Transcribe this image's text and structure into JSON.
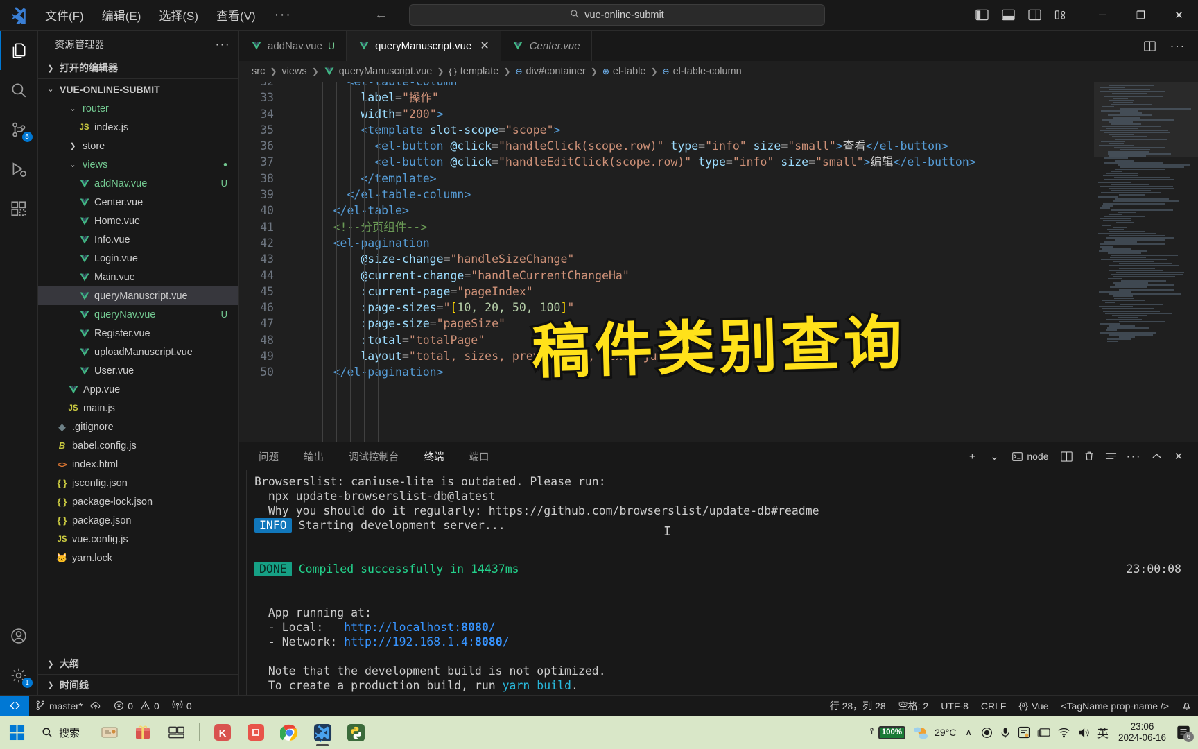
{
  "titlebar": {
    "menus": [
      "文件(F)",
      "编辑(E)",
      "选择(S)",
      "查看(V)"
    ],
    "more": "···",
    "back_icon": "←",
    "forward_icon": "→",
    "command_center_text": "vue-online-submit",
    "search_icon": "search-icon",
    "layout_icons": [
      "toggle-primary-sidebar-icon",
      "toggle-panel-icon",
      "toggle-secondary-sidebar-icon",
      "customize-layout-icon"
    ],
    "window_controls": {
      "minimize": "─",
      "maximize": "❐",
      "close": "✕"
    }
  },
  "activitybar": {
    "items": [
      {
        "name": "explorer",
        "icon": "files-icon",
        "badge": ""
      },
      {
        "name": "search",
        "icon": "search-icon",
        "badge": ""
      },
      {
        "name": "source-control",
        "icon": "source-control-icon",
        "badge": "5"
      },
      {
        "name": "run-and-debug",
        "icon": "debug-icon",
        "badge": ""
      },
      {
        "name": "extensions",
        "icon": "extensions-icon",
        "badge": ""
      }
    ],
    "bottom": [
      {
        "name": "accounts",
        "icon": "account-icon",
        "badge": ""
      },
      {
        "name": "manage",
        "icon": "gear-icon",
        "badge": "1"
      }
    ]
  },
  "sidebar": {
    "title": "资源管理器",
    "more": "···",
    "open_editors": "打开的编辑器",
    "project_name": "VUE-ONLINE-SUBMIT",
    "tree": [
      {
        "label": "router",
        "type": "folder",
        "open": true,
        "indent": 2,
        "badge": ""
      },
      {
        "label": "index.js",
        "type": "js",
        "indent": 3,
        "badge": ""
      },
      {
        "label": "store",
        "type": "folder",
        "open": false,
        "indent": 2,
        "badge": ""
      },
      {
        "label": "views",
        "type": "folder",
        "open": true,
        "indent": 2,
        "badge": "",
        "modified": true
      },
      {
        "label": "addNav.vue",
        "type": "vue",
        "indent": 3,
        "badge": "U",
        "untracked": true
      },
      {
        "label": "Center.vue",
        "type": "vue",
        "indent": 3,
        "badge": ""
      },
      {
        "label": "Home.vue",
        "type": "vue",
        "indent": 3,
        "badge": ""
      },
      {
        "label": "Info.vue",
        "type": "vue",
        "indent": 3,
        "badge": ""
      },
      {
        "label": "Login.vue",
        "type": "vue",
        "indent": 3,
        "badge": ""
      },
      {
        "label": "Main.vue",
        "type": "vue",
        "indent": 3,
        "badge": ""
      },
      {
        "label": "queryManuscript.vue",
        "type": "vue",
        "indent": 3,
        "badge": "",
        "selected": true
      },
      {
        "label": "queryNav.vue",
        "type": "vue",
        "indent": 3,
        "badge": "U",
        "untracked": true
      },
      {
        "label": "Register.vue",
        "type": "vue",
        "indent": 3,
        "badge": ""
      },
      {
        "label": "uploadManuscript.vue",
        "type": "vue",
        "indent": 3,
        "badge": ""
      },
      {
        "label": "User.vue",
        "type": "vue",
        "indent": 3,
        "badge": ""
      },
      {
        "label": "App.vue",
        "type": "vue",
        "indent": 2,
        "badge": ""
      },
      {
        "label": "main.js",
        "type": "js",
        "indent": 2,
        "badge": ""
      },
      {
        "label": ".gitignore",
        "type": "git",
        "indent": 1,
        "badge": ""
      },
      {
        "label": "babel.config.js",
        "type": "babel",
        "indent": 1,
        "badge": ""
      },
      {
        "label": "index.html",
        "type": "html",
        "indent": 1,
        "badge": ""
      },
      {
        "label": "jsconfig.json",
        "type": "json",
        "indent": 1,
        "badge": ""
      },
      {
        "label": "package-lock.json",
        "type": "json",
        "indent": 1,
        "badge": ""
      },
      {
        "label": "package.json",
        "type": "json",
        "indent": 1,
        "badge": ""
      },
      {
        "label": "vue.config.js",
        "type": "js",
        "indent": 1,
        "badge": ""
      },
      {
        "label": "yarn.lock",
        "type": "yarn",
        "indent": 1,
        "badge": ""
      }
    ],
    "outline": "大纲",
    "timeline": "时间线"
  },
  "editor": {
    "tabs": [
      {
        "label": "addNav.vue",
        "badge": "U",
        "active": false,
        "preview": false,
        "closable": false
      },
      {
        "label": "queryManuscript.vue",
        "badge": "",
        "active": true,
        "preview": false,
        "closable": true
      },
      {
        "label": "Center.vue",
        "badge": "",
        "active": false,
        "preview": true,
        "closable": false
      }
    ],
    "tab_actions": [
      "split-editor-icon",
      "more-actions-icon"
    ],
    "breadcrumb": [
      "src",
      "views",
      "queryManuscript.vue",
      "template",
      "div#container",
      "el-table",
      "el-table-column"
    ],
    "first_visible_line": 32,
    "lines": [
      {
        "n": 32,
        "segments": [
          {
            "t": "        ",
            "c": "txt"
          },
          {
            "t": "<el-table-column",
            "c": "tag"
          }
        ]
      },
      {
        "n": 33,
        "segments": [
          {
            "t": "          ",
            "c": "txt"
          },
          {
            "t": "label",
            "c": "attr"
          },
          {
            "t": "=",
            "c": "punc"
          },
          {
            "t": "\"操作\"",
            "c": "str"
          }
        ]
      },
      {
        "n": 34,
        "segments": [
          {
            "t": "          ",
            "c": "txt"
          },
          {
            "t": "width",
            "c": "attr"
          },
          {
            "t": "=",
            "c": "punc"
          },
          {
            "t": "\"200\"",
            "c": "str"
          },
          {
            "t": ">",
            "c": "tag"
          }
        ]
      },
      {
        "n": 35,
        "segments": [
          {
            "t": "          ",
            "c": "txt"
          },
          {
            "t": "<template ",
            "c": "tag"
          },
          {
            "t": "slot-scope",
            "c": "attr"
          },
          {
            "t": "=",
            "c": "punc"
          },
          {
            "t": "\"scope\"",
            "c": "str"
          },
          {
            "t": ">",
            "c": "tag"
          }
        ]
      },
      {
        "n": 36,
        "segments": [
          {
            "t": "            ",
            "c": "txt"
          },
          {
            "t": "<el-button ",
            "c": "tag"
          },
          {
            "t": "@click",
            "c": "attr"
          },
          {
            "t": "=",
            "c": "punc"
          },
          {
            "t": "\"handleClick(scope.row)\"",
            "c": "str"
          },
          {
            "t": " type",
            "c": "attr"
          },
          {
            "t": "=",
            "c": "punc"
          },
          {
            "t": "\"info\"",
            "c": "str"
          },
          {
            "t": " size",
            "c": "attr"
          },
          {
            "t": "=",
            "c": "punc"
          },
          {
            "t": "\"small\"",
            "c": "str"
          },
          {
            "t": ">",
            "c": "tag"
          },
          {
            "t": "查看",
            "c": "txt"
          },
          {
            "t": "</el-button>",
            "c": "tag"
          }
        ]
      },
      {
        "n": 37,
        "segments": [
          {
            "t": "            ",
            "c": "txt"
          },
          {
            "t": "<el-button ",
            "c": "tag"
          },
          {
            "t": "@click",
            "c": "attr"
          },
          {
            "t": "=",
            "c": "punc"
          },
          {
            "t": "\"handleEditClick(scope.row)\"",
            "c": "str"
          },
          {
            "t": " type",
            "c": "attr"
          },
          {
            "t": "=",
            "c": "punc"
          },
          {
            "t": "\"info\"",
            "c": "str"
          },
          {
            "t": " size",
            "c": "attr"
          },
          {
            "t": "=",
            "c": "punc"
          },
          {
            "t": "\"small\"",
            "c": "str"
          },
          {
            "t": ">",
            "c": "tag"
          },
          {
            "t": "编辑",
            "c": "txt"
          },
          {
            "t": "</el-button>",
            "c": "tag"
          }
        ]
      },
      {
        "n": 38,
        "segments": [
          {
            "t": "          ",
            "c": "txt"
          },
          {
            "t": "</template>",
            "c": "tag"
          }
        ]
      },
      {
        "n": 39,
        "segments": [
          {
            "t": "        ",
            "c": "txt"
          },
          {
            "t": "</el-table-column>",
            "c": "tag"
          }
        ]
      },
      {
        "n": 40,
        "segments": [
          {
            "t": "      ",
            "c": "txt"
          },
          {
            "t": "</el-table>",
            "c": "tag"
          }
        ]
      },
      {
        "n": 41,
        "segments": [
          {
            "t": "      ",
            "c": "txt"
          },
          {
            "t": "<!--分页组件-->",
            "c": "cmt"
          }
        ]
      },
      {
        "n": 42,
        "segments": [
          {
            "t": "      ",
            "c": "txt"
          },
          {
            "t": "<el-pagination",
            "c": "tag"
          }
        ]
      },
      {
        "n": 43,
        "segments": [
          {
            "t": "          ",
            "c": "txt"
          },
          {
            "t": "@size-change",
            "c": "attr"
          },
          {
            "t": "=",
            "c": "punc"
          },
          {
            "t": "\"handleSizeChange\"",
            "c": "str"
          }
        ]
      },
      {
        "n": 44,
        "segments": [
          {
            "t": "          ",
            "c": "txt"
          },
          {
            "t": "@current-change",
            "c": "attr"
          },
          {
            "t": "=",
            "c": "punc"
          },
          {
            "t": "\"handleCurrentChangeHa\"",
            "c": "str"
          }
        ]
      },
      {
        "n": 45,
        "segments": [
          {
            "t": "          ",
            "c": "txt"
          },
          {
            "t": ":current-page",
            "c": "attr"
          },
          {
            "t": "=",
            "c": "punc"
          },
          {
            "t": "\"pageIndex\"",
            "c": "str"
          }
        ]
      },
      {
        "n": 46,
        "segments": [
          {
            "t": "          ",
            "c": "txt"
          },
          {
            "t": ":page-sizes",
            "c": "attr"
          },
          {
            "t": "=",
            "c": "punc"
          },
          {
            "t": "\"",
            "c": "str"
          },
          {
            "t": "[",
            "c": "brk"
          },
          {
            "t": "10, 20, 50, 100",
            "c": "num"
          },
          {
            "t": "]",
            "c": "brk"
          },
          {
            "t": "\"",
            "c": "str"
          }
        ]
      },
      {
        "n": 47,
        "segments": [
          {
            "t": "          ",
            "c": "txt"
          },
          {
            "t": ":page-size",
            "c": "attr"
          },
          {
            "t": "=",
            "c": "punc"
          },
          {
            "t": "\"pageSize\"",
            "c": "str"
          }
        ]
      },
      {
        "n": 48,
        "segments": [
          {
            "t": "          ",
            "c": "txt"
          },
          {
            "t": ":total",
            "c": "attr"
          },
          {
            "t": "=",
            "c": "punc"
          },
          {
            "t": "\"totalPage\"",
            "c": "str"
          }
        ]
      },
      {
        "n": 49,
        "segments": [
          {
            "t": "          ",
            "c": "txt"
          },
          {
            "t": "layout",
            "c": "attr"
          },
          {
            "t": "=",
            "c": "punc"
          },
          {
            "t": "\"total, sizes, prev, pager, next, jumper\"",
            "c": "str"
          },
          {
            "t": ">",
            "c": "tag"
          }
        ]
      },
      {
        "n": 50,
        "segments": [
          {
            "t": "      ",
            "c": "txt"
          },
          {
            "t": "</el-pagination>",
            "c": "tag"
          }
        ]
      }
    ],
    "overlay_text": "稿件类别查询"
  },
  "panel": {
    "tabs": [
      "问题",
      "输出",
      "调试控制台",
      "终端",
      "端口"
    ],
    "active_tab": "终端",
    "actions": {
      "new_terminal": "+",
      "dropdown": "⌄",
      "shell_label": "node",
      "split": "split-terminal-icon",
      "kill": "trash-icon",
      "clear": "clear-icon",
      "more": "···",
      "maximize": "chevron-up-icon",
      "close": "✕"
    },
    "terminal_lines": [
      {
        "text": "Browserslist: caniuse-lite is outdated. Please run:",
        "style": "plain"
      },
      {
        "text": "  npx update-browserslist-db@latest",
        "style": "plain"
      },
      {
        "text": "  Why you should do it regularly: https://github.com/browserslist/update-db#readme",
        "style": "plain"
      },
      {
        "text": " Starting development server...",
        "style": "info",
        "chip": "INFO"
      },
      {
        "text": "",
        "style": "plain"
      },
      {
        "text": "",
        "style": "plain"
      },
      {
        "text": "Compiled successfully in 14437ms",
        "style": "done",
        "chip": "DONE",
        "right": "23:00:08"
      },
      {
        "text": "",
        "style": "plain"
      },
      {
        "text": "",
        "style": "plain"
      },
      {
        "text": "  App running at:",
        "style": "plain"
      },
      {
        "text": "  - Local:   http://localhost:8080/",
        "style": "link-local"
      },
      {
        "text": "  - Network: http://192.168.1.4:8080/",
        "style": "link-network"
      },
      {
        "text": "",
        "style": "plain"
      },
      {
        "text": "  Note that the development build is not optimized.",
        "style": "plain"
      },
      {
        "text": "  To create a production build, run yarn build.",
        "style": "build"
      }
    ]
  },
  "statusbar": {
    "remote_icon": "remote-window-icon",
    "branch": "master*",
    "sync_icon": "sync-icon",
    "errors_icon": "error-icon",
    "errors": "0",
    "warnings_icon": "warning-icon",
    "warnings": "0",
    "ports_icon": "radio-tower-icon",
    "ports": "0",
    "cursor_position": "行 28，列 28",
    "indentation": "空格: 2",
    "encoding": "UTF-8",
    "eol": "CRLF",
    "language_icon": "vue-lang-icon",
    "language": "Vue",
    "tag_hint": "<TagName prop-name />",
    "bell_icon": "bell-icon"
  },
  "taskbar": {
    "start_icon": "windows-start-icon",
    "search_placeholder": "搜索",
    "apps": [
      {
        "name": "widgets-icon"
      },
      {
        "name": "gift-icon"
      },
      {
        "name": "task-view-icon"
      },
      {
        "name": "kingsoft-icon"
      },
      {
        "name": "app-icon-5"
      },
      {
        "name": "chrome-icon"
      },
      {
        "name": "vscode-icon",
        "active": true
      },
      {
        "name": "python-icon"
      }
    ],
    "tray": {
      "battery_percent": "100%",
      "weather_temp": "29°C",
      "weather_icon": "partly-cloudy-icon",
      "chevron": "∧",
      "icons": [
        "record-icon",
        "microphone-icon",
        "ime-panel-icon",
        "gallery-icon",
        "wifi-icon",
        "volume-icon"
      ],
      "ime": "英",
      "time": "23:06",
      "date": "2024-06-16",
      "notification_count": "6",
      "notification_icon": "notification-icon"
    }
  },
  "colors": {
    "accent": "#0078d4",
    "tab_active_bg": "#1f1f1f",
    "editor_bg": "#1f1f1f",
    "sidebar_bg": "#181818",
    "overlay_yellow": "#ffe11a",
    "done_chip": "#16a085",
    "info_chip": "#1177bb",
    "taskbar_bg": "#d9e7c8"
  }
}
